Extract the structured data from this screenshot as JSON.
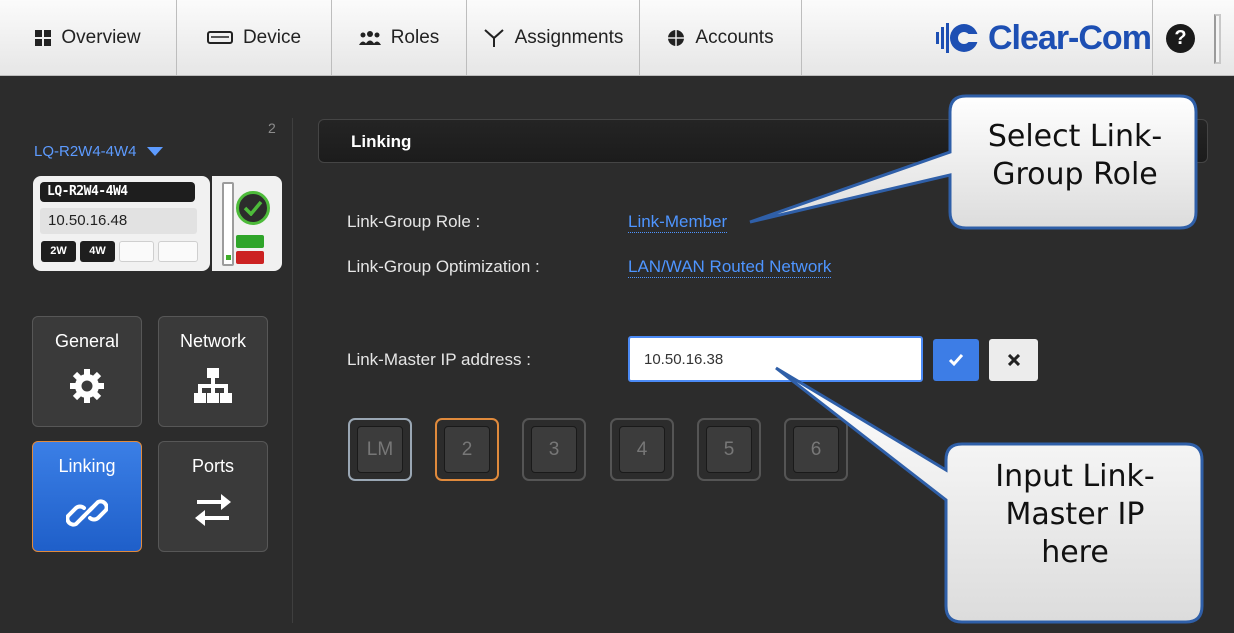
{
  "nav": {
    "tabs": [
      {
        "label": "Overview",
        "icon": "grid-icon"
      },
      {
        "label": "Device",
        "icon": "device-icon"
      },
      {
        "label": "Roles",
        "icon": "users-icon"
      },
      {
        "label": "Assignments",
        "icon": "assignments-icon"
      },
      {
        "label": "Accounts",
        "icon": "globe-icon"
      }
    ],
    "logo_text": "Clear-Com",
    "help_label": "?"
  },
  "sidebar": {
    "slot_number": "2",
    "device_selector": "LQ-R2W4-4W4",
    "device_card": {
      "name": "LQ-R2W4-4W4",
      "ip": "10.50.16.48",
      "ports": [
        "2W",
        "4W",
        "",
        ""
      ],
      "status": "connected"
    },
    "tiles": [
      {
        "label": "General",
        "icon": "gear-icon"
      },
      {
        "label": "Network",
        "icon": "network-icon"
      },
      {
        "label": "Linking",
        "icon": "link-icon",
        "active": true
      },
      {
        "label": "Ports",
        "icon": "swap-arrows-icon"
      }
    ]
  },
  "main": {
    "section_title": "Linking",
    "fields": {
      "link_group_role_label": "Link-Group Role :",
      "link_group_role_value": "Link-Member",
      "link_group_optimization_label": "Link-Group Optimization :",
      "link_group_optimization_value": "LAN/WAN Routed Network",
      "link_master_ip_label": "Link-Master IP address :",
      "link_master_ip_value": "10.50.16.38"
    },
    "members": [
      "LM",
      "2",
      "3",
      "4",
      "5",
      "6"
    ]
  },
  "callouts": {
    "role": "Select Link-Group Role",
    "role_line1": "Select Link-",
    "role_line2": "Group Role",
    "ip": "Input Link-Master IP here",
    "ip_line1": "Input Link-",
    "ip_line2": "Master IP",
    "ip_line3": "here"
  },
  "colors": {
    "accent": "#3d7de6",
    "link_text": "#4e95ff",
    "logo": "#1d4fb3",
    "active_border": "#e08a3c"
  }
}
